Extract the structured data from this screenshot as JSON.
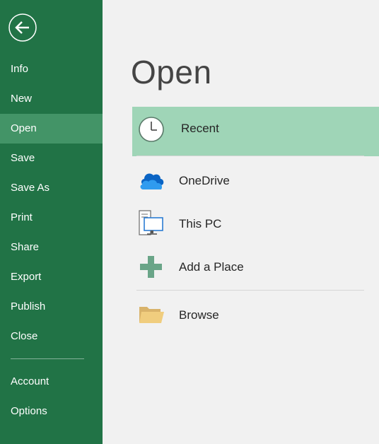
{
  "sidebar": {
    "items": [
      {
        "label": "Info"
      },
      {
        "label": "New"
      },
      {
        "label": "Open"
      },
      {
        "label": "Save"
      },
      {
        "label": "Save As"
      },
      {
        "label": "Print"
      },
      {
        "label": "Share"
      },
      {
        "label": "Export"
      },
      {
        "label": "Publish"
      },
      {
        "label": "Close"
      }
    ],
    "bottom_items": [
      {
        "label": "Account"
      },
      {
        "label": "Options"
      }
    ],
    "active": "Open"
  },
  "main": {
    "title": "Open",
    "places": [
      {
        "label": "Recent",
        "icon": "clock-icon",
        "selected": true
      },
      {
        "label": "OneDrive",
        "icon": "onedrive-cloud-icon"
      },
      {
        "label": "This PC",
        "icon": "computer-icon"
      },
      {
        "label": "Add a Place",
        "icon": "plus-icon"
      },
      {
        "label": "Browse",
        "icon": "folder-icon"
      }
    ]
  },
  "colors": {
    "sidebar_bg": "#217346",
    "sidebar_active": "#439467",
    "selected_place_bg": "#9fd5b7",
    "main_bg": "#f1f1f1"
  }
}
